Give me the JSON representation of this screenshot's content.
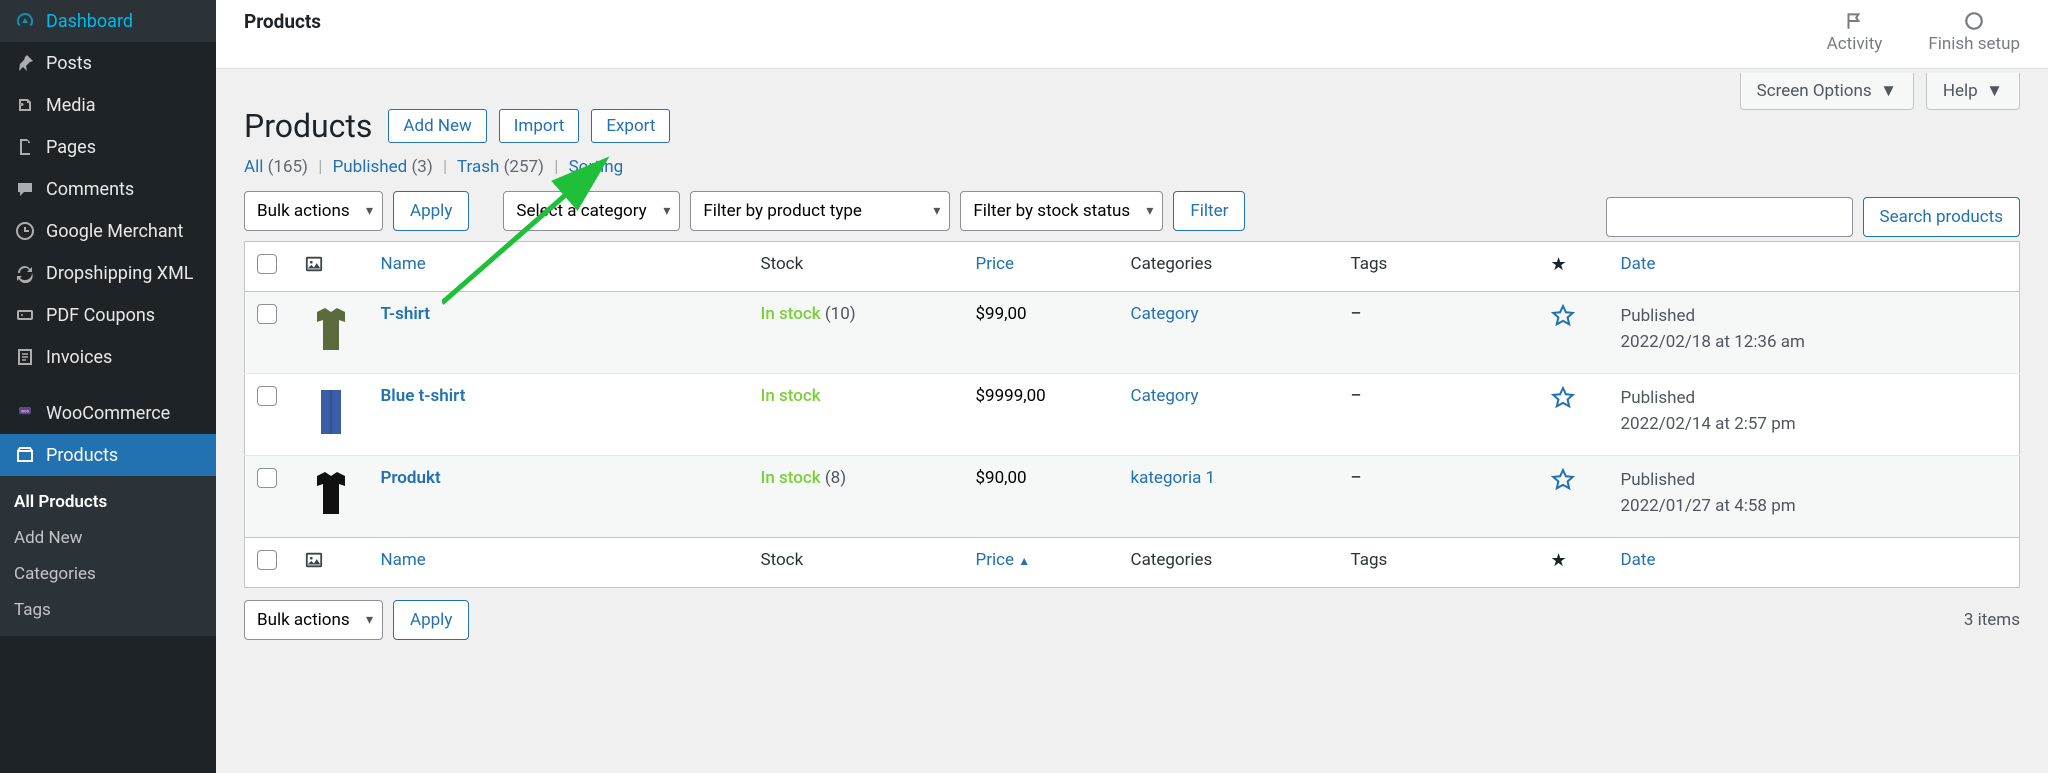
{
  "sidebar": {
    "items": [
      {
        "label": "Dashboard"
      },
      {
        "label": "Posts"
      },
      {
        "label": "Media"
      },
      {
        "label": "Pages"
      },
      {
        "label": "Comments"
      },
      {
        "label": "Google Merchant"
      },
      {
        "label": "Dropshipping XML"
      },
      {
        "label": "PDF Coupons"
      },
      {
        "label": "Invoices"
      },
      {
        "label": "WooCommerce"
      },
      {
        "label": "Products"
      }
    ],
    "sub": [
      {
        "label": "All Products",
        "current": true
      },
      {
        "label": "Add New"
      },
      {
        "label": "Categories"
      },
      {
        "label": "Tags"
      }
    ]
  },
  "topbar": {
    "title": "Products",
    "activity": "Activity",
    "finish": "Finish setup"
  },
  "screen_options": {
    "screen": "Screen Options",
    "help": "Help"
  },
  "header": {
    "title": "Products",
    "add_new": "Add New",
    "import": "Import",
    "export": "Export"
  },
  "views": {
    "all_label": "All",
    "all_count": "(165)",
    "published_label": "Published",
    "published_count": "(3)",
    "trash_label": "Trash",
    "trash_count": "(257)",
    "sorting": "Sorting"
  },
  "filters": {
    "bulk": "Bulk actions",
    "apply": "Apply",
    "category": "Select a category",
    "type": "Filter by product type",
    "stock": "Filter by stock status",
    "filter": "Filter",
    "items": "3 items"
  },
  "search": {
    "placeholder": "",
    "button": "Search products"
  },
  "table": {
    "headers": {
      "name": "Name",
      "stock": "Stock",
      "price": "Price",
      "categories": "Categories",
      "tags": "Tags",
      "date": "Date"
    },
    "rows": [
      {
        "name": "T-shirt",
        "stock_status": "In stock",
        "stock_qty": "(10)",
        "price": "$99,00",
        "category": "Category",
        "tags": "–",
        "date_status": "Published",
        "date_time": "2022/02/18 at 12:36 am",
        "thumb_color": "#5c6b3d"
      },
      {
        "name": "Blue t-shirt",
        "stock_status": "In stock",
        "stock_qty": "",
        "price": "$9999,00",
        "category": "Category",
        "tags": "–",
        "date_status": "Published",
        "date_time": "2022/02/14 at 2:57 pm",
        "thumb_color": "#3a5da8"
      },
      {
        "name": "Produkt",
        "stock_status": "In stock",
        "stock_qty": "(8)",
        "price": "$90,00",
        "category": "kategoria 1",
        "tags": "–",
        "date_status": "Published",
        "date_time": "2022/01/27 at 4:58 pm",
        "thumb_color": "#111111"
      }
    ]
  }
}
